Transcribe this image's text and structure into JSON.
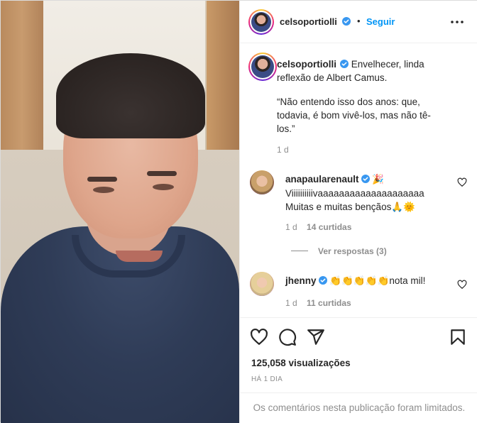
{
  "post": {
    "author": "celsoportiolli",
    "separator": "•",
    "follow_label": "Seguir",
    "more_icon": "more-horizontal-icon"
  },
  "caption": {
    "username": "celsoportiolli",
    "text": "Envelhecer, linda reflexão de Albert Camus.",
    "quote": "“Não entendo isso dos anos: que, todavia, é bom vivê-los, mas não tê-los.”",
    "time": "1 d"
  },
  "comments": [
    {
      "username": "anapaulaenault",
      "display_username": "anapaularenault",
      "badge_emoji": "🎉",
      "line1": "Viiiiiiiiiivaaaaaaaaaaaaaaaaaaaa",
      "line2": "Muitas e muitas bençãos🙏🌞",
      "time": "1 d",
      "likes": "14 curtidas",
      "replies_label": "Ver respostas (3)"
    },
    {
      "username": "jhenny",
      "emojis": "👏👏👏👏👏",
      "text": "nota mil!",
      "time": "1 d",
      "likes": "11 curtidas"
    }
  ],
  "actions": {
    "like_icon": "heart-icon",
    "comment_icon": "comment-icon",
    "share_icon": "send-icon",
    "save_icon": "bookmark-icon"
  },
  "stats": {
    "views": "125,058 visualizações",
    "posted_ago": "HÁ 1 DIA"
  },
  "footer": {
    "limited_text": "Os comentários nesta publicação foram limitados."
  },
  "colors": {
    "accent": "#0095f6",
    "verified": "#3897f0",
    "muted": "#8e8e8e",
    "text": "#262626",
    "border": "#efefef"
  }
}
